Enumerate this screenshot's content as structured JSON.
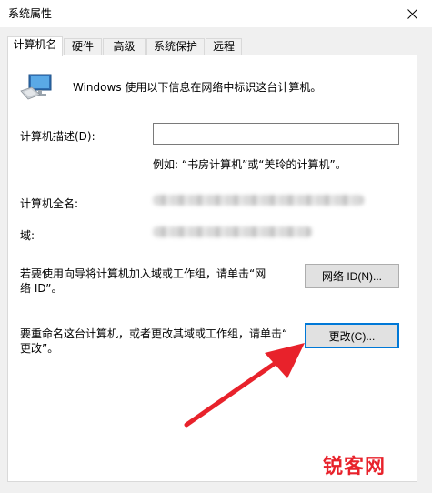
{
  "window": {
    "title": "系统属性"
  },
  "tabs": [
    {
      "label": "计算机名",
      "active": true
    },
    {
      "label": "硬件",
      "active": false
    },
    {
      "label": "高级",
      "active": false
    },
    {
      "label": "系统保护",
      "active": false
    },
    {
      "label": "远程",
      "active": false
    }
  ],
  "computer_name": {
    "intro": "Windows 使用以下信息在网络中标识这台计算机。",
    "description_label": "计算机描述(D):",
    "description_value": "",
    "description_example": "例如: “书房计算机”或“美玲的计算机”。",
    "full_name_label": "计算机全名:",
    "domain_label": "域:",
    "network_text_line1": "若要使用向导将计算机加入域或工作组，请单击“网",
    "network_text_line2": "络 ID”。",
    "network_button": "网络 ID(N)...",
    "rename_text_line1": "要重命名这台计算机，或者更改其域或工作组，请单击“",
    "rename_text_line2": "更改”。",
    "change_button": "更改(C)..."
  },
  "watermark": "锐客网",
  "colors": {
    "focus_border": "#0078d7",
    "arrow": "#e8222b",
    "watermark": "#e8222b"
  }
}
